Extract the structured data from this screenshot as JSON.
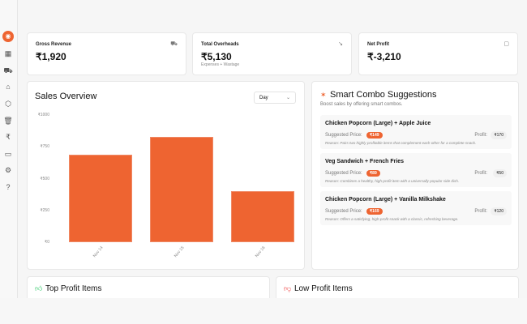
{
  "sidebar": {
    "items": [
      "dashboard",
      "cart",
      "chef-hat",
      "box",
      "trash",
      "rupee",
      "card",
      "settings",
      "help"
    ]
  },
  "kpis": [
    {
      "label": "Gross Revenue",
      "value": "₹1,920",
      "icon": "cart-icon"
    },
    {
      "label": "Total Overheads",
      "value": "₹5,130",
      "sub": "Expenses + Wastage",
      "icon": "trend-down-icon"
    },
    {
      "label": "Net Profit",
      "value": "₹-3,210",
      "icon": "receipt-icon"
    }
  ],
  "sales": {
    "title": "Sales Overview",
    "period": "Day"
  },
  "chart_data": {
    "type": "bar",
    "categories": [
      "Nov 14",
      "Nov 15",
      "Nov 16"
    ],
    "values": [
      690,
      830,
      400
    ],
    "yticks": [
      "₹1000",
      "₹750",
      "₹500",
      "₹250",
      "₹0"
    ],
    "ylim": [
      0,
      1000
    ],
    "color": "#ee6431"
  },
  "combos": {
    "title": "Smart Combo Suggestions",
    "subtitle": "Boost sales by offering smart combos.",
    "suggested_label": "Suggested Price:",
    "profit_label": "Profit:",
    "items": [
      {
        "name": "Chicken Popcorn (Large) + Apple Juice",
        "price": "₹149",
        "profit": "₹170",
        "reason": "Reason: Pairs two highly profitable items that complement each other for a complete snack."
      },
      {
        "name": "Veg Sandwich + French Fries",
        "price": "₹89",
        "profit": "₹50",
        "reason": "Reason: Combines a healthy, high-profit item with a universally popular side dish."
      },
      {
        "name": "Chicken Popcorn (Large) + Vanilla Milkshake",
        "price": "₹169",
        "profit": "₹120",
        "reason": "Reason: Offers a satisfying, high-profit snack with a classic, refreshing beverage."
      }
    ]
  },
  "top_profit": {
    "title": "Top Profit Items"
  },
  "low_profit": {
    "title": "Low Profit Items"
  },
  "colors": {
    "accent": "#ee6431",
    "good": "#22c55e",
    "bad": "#ef4444"
  }
}
